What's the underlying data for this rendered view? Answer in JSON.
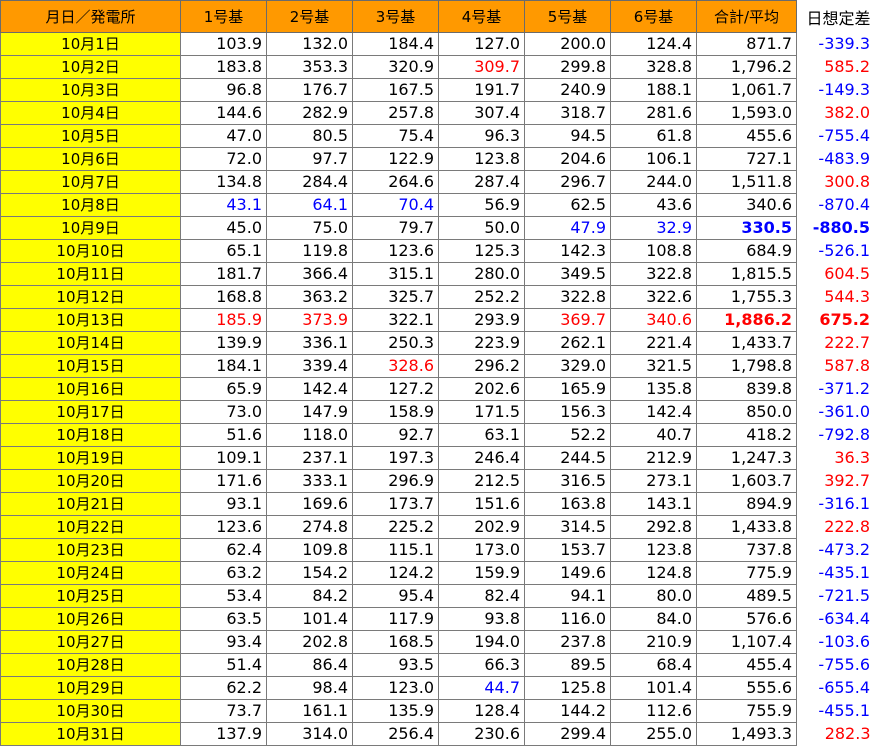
{
  "header": {
    "date_plant": "月日／発電所",
    "units": [
      "1号基",
      "2号基",
      "3号基",
      "4号基",
      "5号基",
      "6号基"
    ],
    "total": "合計/平均",
    "diff": "日想定差"
  },
  "colors": {
    "header_bg": "#ff9900",
    "date_bg": "#ffff00",
    "high": "#ff0000",
    "low": "#0000ff",
    "text": "#000000"
  },
  "rows": [
    {
      "date": "10月1日",
      "vals": [
        "103.9",
        "132.0",
        "184.4",
        "127.0",
        "200.0",
        "124.4"
      ],
      "total": "871.7",
      "diff": "-339.3"
    },
    {
      "date": "10月2日",
      "vals": [
        "183.8",
        "353.3",
        "320.9",
        "309.7",
        "299.8",
        "328.8"
      ],
      "total": "1,796.2",
      "diff": "585.2"
    },
    {
      "date": "10月3日",
      "vals": [
        "96.8",
        "176.7",
        "167.5",
        "191.7",
        "240.9",
        "188.1"
      ],
      "total": "1,061.7",
      "diff": "-149.3"
    },
    {
      "date": "10月4日",
      "vals": [
        "144.6",
        "282.9",
        "257.8",
        "307.4",
        "318.7",
        "281.6"
      ],
      "total": "1,593.0",
      "diff": "382.0"
    },
    {
      "date": "10月5日",
      "vals": [
        "47.0",
        "80.5",
        "75.4",
        "96.3",
        "94.5",
        "61.8"
      ],
      "total": "455.6",
      "diff": "-755.4"
    },
    {
      "date": "10月6日",
      "vals": [
        "72.0",
        "97.7",
        "122.9",
        "123.8",
        "204.6",
        "106.1"
      ],
      "total": "727.1",
      "diff": "-483.9"
    },
    {
      "date": "10月7日",
      "vals": [
        "134.8",
        "284.4",
        "264.6",
        "287.4",
        "296.7",
        "244.0"
      ],
      "total": "1,511.8",
      "diff": "300.8"
    },
    {
      "date": "10月8日",
      "vals": [
        "43.1",
        "64.1",
        "70.4",
        "56.9",
        "62.5",
        "43.6"
      ],
      "total": "340.6",
      "diff": "-870.4"
    },
    {
      "date": "10月9日",
      "vals": [
        "45.0",
        "75.0",
        "79.7",
        "50.0",
        "47.9",
        "32.9"
      ],
      "total": "330.5",
      "diff": "-880.5"
    },
    {
      "date": "10月10日",
      "vals": [
        "65.1",
        "119.8",
        "123.6",
        "125.3",
        "142.3",
        "108.8"
      ],
      "total": "684.9",
      "diff": "-526.1"
    },
    {
      "date": "10月11日",
      "vals": [
        "181.7",
        "366.4",
        "315.1",
        "280.0",
        "349.5",
        "322.8"
      ],
      "total": "1,815.5",
      "diff": "604.5"
    },
    {
      "date": "10月12日",
      "vals": [
        "168.8",
        "363.2",
        "325.7",
        "252.2",
        "322.8",
        "322.6"
      ],
      "total": "1,755.3",
      "diff": "544.3"
    },
    {
      "date": "10月13日",
      "vals": [
        "185.9",
        "373.9",
        "322.1",
        "293.9",
        "369.7",
        "340.6"
      ],
      "total": "1,886.2",
      "diff": "675.2"
    },
    {
      "date": "10月14日",
      "vals": [
        "139.9",
        "336.1",
        "250.3",
        "223.9",
        "262.1",
        "221.4"
      ],
      "total": "1,433.7",
      "diff": "222.7"
    },
    {
      "date": "10月15日",
      "vals": [
        "184.1",
        "339.4",
        "328.6",
        "296.2",
        "329.0",
        "321.5"
      ],
      "total": "1,798.8",
      "diff": "587.8"
    },
    {
      "date": "10月16日",
      "vals": [
        "65.9",
        "142.4",
        "127.2",
        "202.6",
        "165.9",
        "135.8"
      ],
      "total": "839.8",
      "diff": "-371.2"
    },
    {
      "date": "10月17日",
      "vals": [
        "73.0",
        "147.9",
        "158.9",
        "171.5",
        "156.3",
        "142.4"
      ],
      "total": "850.0",
      "diff": "-361.0"
    },
    {
      "date": "10月18日",
      "vals": [
        "51.6",
        "118.0",
        "92.7",
        "63.1",
        "52.2",
        "40.7"
      ],
      "total": "418.2",
      "diff": "-792.8"
    },
    {
      "date": "10月19日",
      "vals": [
        "109.1",
        "237.1",
        "197.3",
        "246.4",
        "244.5",
        "212.9"
      ],
      "total": "1,247.3",
      "diff": "36.3"
    },
    {
      "date": "10月20日",
      "vals": [
        "171.6",
        "333.1",
        "296.9",
        "212.5",
        "316.5",
        "273.1"
      ],
      "total": "1,603.7",
      "diff": "392.7"
    },
    {
      "date": "10月21日",
      "vals": [
        "93.1",
        "169.6",
        "173.7",
        "151.6",
        "163.8",
        "143.1"
      ],
      "total": "894.9",
      "diff": "-316.1"
    },
    {
      "date": "10月22日",
      "vals": [
        "123.6",
        "274.8",
        "225.2",
        "202.9",
        "314.5",
        "292.8"
      ],
      "total": "1,433.8",
      "diff": "222.8"
    },
    {
      "date": "10月23日",
      "vals": [
        "62.4",
        "109.8",
        "115.1",
        "173.0",
        "153.7",
        "123.8"
      ],
      "total": "737.8",
      "diff": "-473.2"
    },
    {
      "date": "10月24日",
      "vals": [
        "63.2",
        "154.2",
        "124.2",
        "159.9",
        "149.6",
        "124.8"
      ],
      "total": "775.9",
      "diff": "-435.1"
    },
    {
      "date": "10月25日",
      "vals": [
        "53.4",
        "84.2",
        "95.4",
        "82.4",
        "94.1",
        "80.0"
      ],
      "total": "489.5",
      "diff": "-721.5"
    },
    {
      "date": "10月26日",
      "vals": [
        "63.5",
        "101.4",
        "117.9",
        "93.8",
        "116.0",
        "84.0"
      ],
      "total": "576.6",
      "diff": "-634.4"
    },
    {
      "date": "10月27日",
      "vals": [
        "93.4",
        "202.8",
        "168.5",
        "194.0",
        "237.8",
        "210.9"
      ],
      "total": "1,107.4",
      "diff": "-103.6"
    },
    {
      "date": "10月28日",
      "vals": [
        "51.4",
        "86.4",
        "93.5",
        "66.3",
        "89.5",
        "68.4"
      ],
      "total": "455.4",
      "diff": "-755.6"
    },
    {
      "date": "10月29日",
      "vals": [
        "62.2",
        "98.4",
        "123.0",
        "44.7",
        "125.8",
        "101.4"
      ],
      "total": "555.6",
      "diff": "-655.4"
    },
    {
      "date": "10月30日",
      "vals": [
        "73.7",
        "161.1",
        "135.9",
        "128.4",
        "144.2",
        "112.6"
      ],
      "total": "755.9",
      "diff": "-455.1"
    },
    {
      "date": "10月31日",
      "vals": [
        "137.9",
        "314.0",
        "256.4",
        "230.6",
        "299.4",
        "255.0"
      ],
      "total": "1,493.3",
      "diff": "282.3"
    }
  ]
}
